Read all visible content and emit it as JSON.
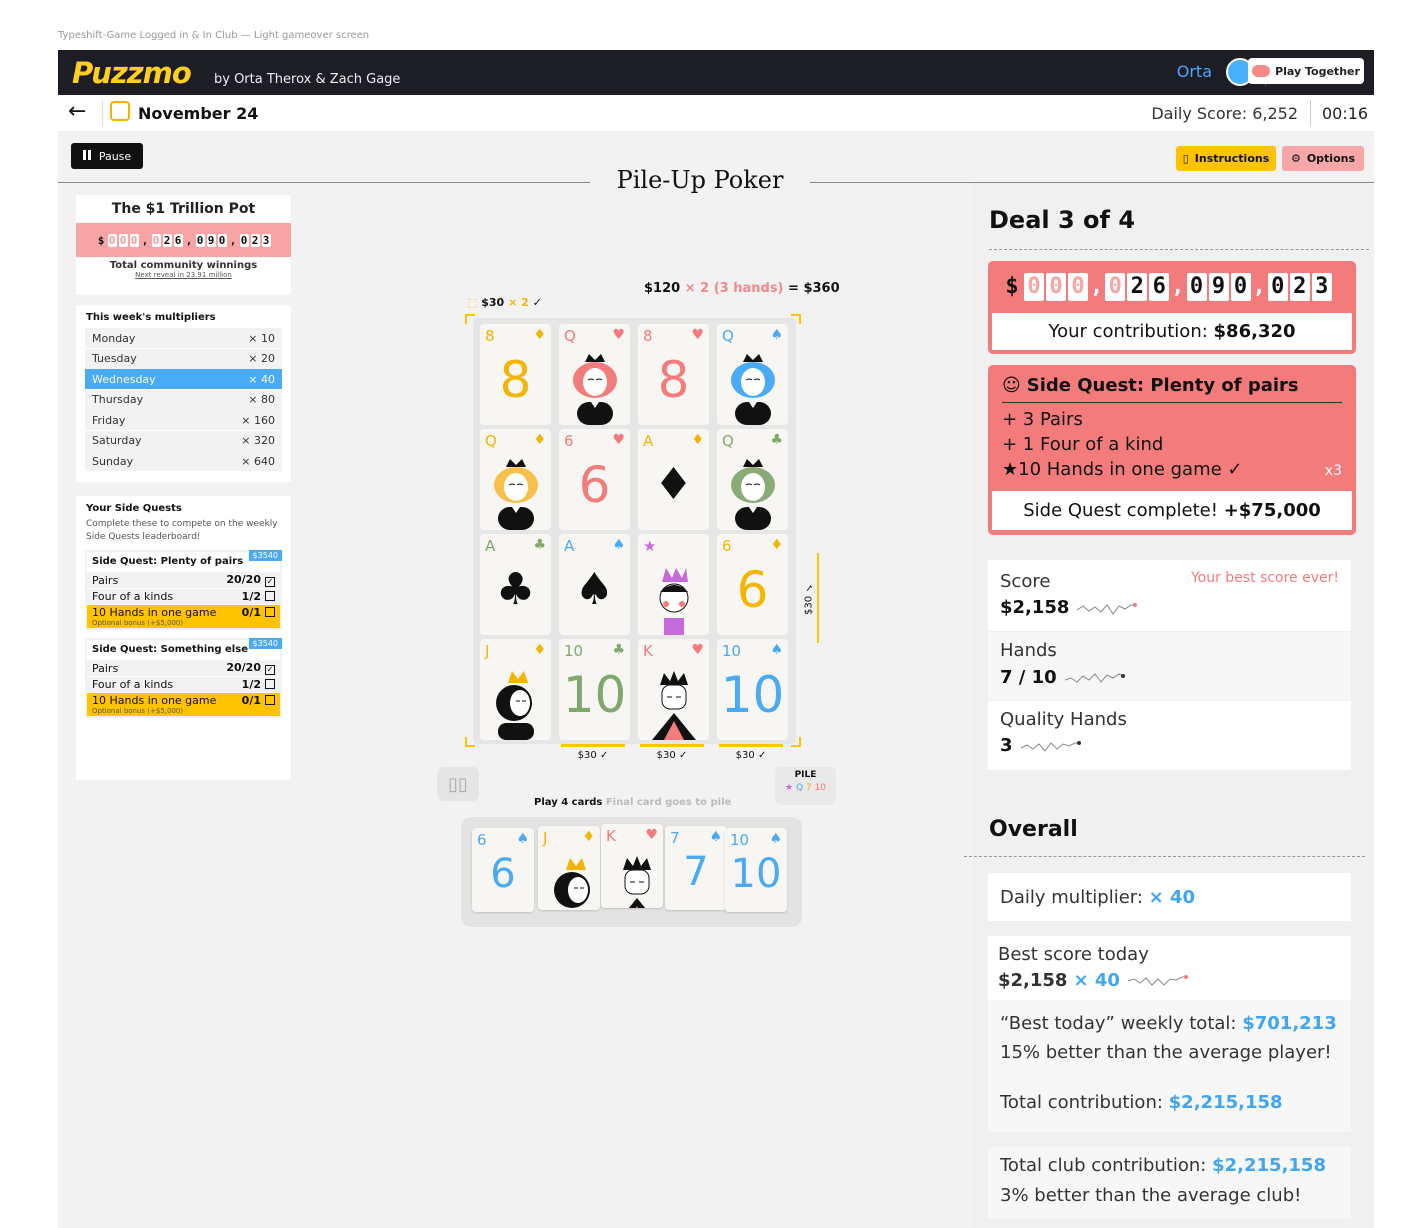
{
  "caption": "Typeshift-Game Logged in & In Club — Light gameover screen",
  "header": {
    "logo": "Puzzmo",
    "byline": "by Orta Therox & Zach Gage",
    "username": "Orta",
    "play_together": "Play Together"
  },
  "datebar": {
    "date": "November 24",
    "daily_score": "Daily Score: 6,252",
    "timer": "00:16"
  },
  "toolbar": {
    "pause": "Pause",
    "instructions": "Instructions",
    "options": "Options",
    "game_title": "Pile-Up Poker"
  },
  "pot": {
    "title": "The $1 Trillion Pot",
    "digits": [
      "0",
      "0",
      "0",
      "0",
      "2",
      "6",
      "0",
      "9",
      "0",
      "0",
      "2",
      "3"
    ],
    "currency": "$",
    "label": "Total community winnings",
    "next_reveal": "Next reveal in 23.91 million"
  },
  "multipliers": {
    "title": "This week's multipliers",
    "days": [
      {
        "day": "Monday",
        "mult": "× 10"
      },
      {
        "day": "Tuesday",
        "mult": "× 20"
      },
      {
        "day": "Wednesday",
        "mult": "× 40"
      },
      {
        "day": "Thursday",
        "mult": "× 80"
      },
      {
        "day": "Friday",
        "mult": "× 160"
      },
      {
        "day": "Saturday",
        "mult": "× 320"
      },
      {
        "day": "Sunday",
        "mult": "× 640"
      }
    ],
    "selected_index": 2
  },
  "side_quests": {
    "title": "Your Side Quests",
    "description": "Complete these to compete on the weekly Side Quests leaderboard!",
    "quests": [
      {
        "name": "Side Quest: Plenty of pairs",
        "badge": "$3540",
        "rows": [
          {
            "label": "Pairs",
            "value": "20/20"
          },
          {
            "label": "Four of a kinds",
            "value": "1/2"
          }
        ],
        "optional": {
          "label": "10 Hands in one game",
          "value": "0/1",
          "note": "Optional bonus (+$5,000)"
        }
      },
      {
        "name": "Side Quest: Something else",
        "badge": "$3540",
        "rows": [
          {
            "label": "Pairs",
            "value": "20/20"
          },
          {
            "label": "Four of a kinds",
            "value": "1/2"
          }
        ],
        "optional": {
          "label": "10 Hands in one game",
          "value": "0/1",
          "note": "Optional bonus (+$5,000)"
        }
      }
    ]
  },
  "board": {
    "formula": {
      "base": "$120",
      "mult": "× 2",
      "hands": "(3 hands)",
      "total": "= $360"
    },
    "row_bet": {
      "amount": "$30",
      "mult": "× 2",
      "check": "✓"
    },
    "side_bet": "$30 ✓",
    "column_bets": [
      "$30 ✓",
      "$30 ✓",
      "$30 ✓"
    ],
    "cards": [
      {
        "rank": "8",
        "suit": "♦",
        "color": "#f5b400",
        "kind": "num"
      },
      {
        "rank": "Q",
        "suit": "♥",
        "color": "#f47b7b",
        "kind": "queen",
        "hair": "#f47b7b"
      },
      {
        "rank": "8",
        "suit": "♥",
        "color": "#f47b7b",
        "kind": "num"
      },
      {
        "rank": "Q",
        "suit": "♠",
        "color": "#49aaf5",
        "kind": "queen",
        "hair": "#49aaf5"
      },
      {
        "rank": "Q",
        "suit": "♦",
        "color": "#f5b400",
        "kind": "queen",
        "hair": "#f7c04a"
      },
      {
        "rank": "6",
        "suit": "♥",
        "color": "#f47b7b",
        "kind": "num"
      },
      {
        "rank": "A",
        "suit": "♦",
        "color": "#f5b400",
        "kind": "ace"
      },
      {
        "rank": "Q",
        "suit": "♣",
        "color": "#7fa96a",
        "kind": "queen",
        "hair": "#8aab78"
      },
      {
        "rank": "A",
        "suit": "♣",
        "color": "#7fa96a",
        "kind": "ace"
      },
      {
        "rank": "A",
        "suit": "♠",
        "color": "#49aaf5",
        "kind": "ace"
      },
      {
        "rank": "★",
        "suit": "",
        "color": "#c56bd9",
        "kind": "joker"
      },
      {
        "rank": "6",
        "suit": "♦",
        "color": "#f5b400",
        "kind": "num"
      },
      {
        "rank": "J",
        "suit": "♦",
        "color": "#f5b400",
        "kind": "jack"
      },
      {
        "rank": "10",
        "suit": "♣",
        "color": "#7fa96a",
        "kind": "num"
      },
      {
        "rank": "K",
        "suit": "♥",
        "color": "#f47b7b",
        "kind": "king"
      },
      {
        "rank": "10",
        "suit": "♠",
        "color": "#49aaf5",
        "kind": "num"
      }
    ],
    "pile": {
      "label": "PILE",
      "cards": [
        "★",
        "Q",
        "7",
        "10"
      ]
    },
    "play_label": "Play 4 cards",
    "play_hint": "Final card goes to pile",
    "hand": [
      {
        "rank": "6",
        "suit": "♠",
        "color": "#49aaf5",
        "kind": "num"
      },
      {
        "rank": "J",
        "suit": "♦",
        "color": "#f5b400",
        "kind": "jack"
      },
      {
        "rank": "K",
        "suit": "♥",
        "color": "#f47b7b",
        "kind": "king"
      },
      {
        "rank": "7",
        "suit": "♠",
        "color": "#49aaf5",
        "kind": "num"
      },
      {
        "rank": "10",
        "suit": "♠",
        "color": "#49aaf5",
        "kind": "num"
      }
    ]
  },
  "results": {
    "deal": "Deal 3 of 4",
    "your_contribution_label": "Your contribution:",
    "your_contribution": "$86,320",
    "side_quest": {
      "title": "Side Quest: Plenty of pairs",
      "lines": [
        "+ 3 Pairs",
        "+ 1 Four of a kind",
        "★10 Hands in one game ✓"
      ],
      "mult": "x3",
      "complete_label": "Side Quest complete!",
      "complete_value": "+$75,000"
    },
    "score_label": "Score",
    "score": "$2,158",
    "best_ever": "Your best score ever!",
    "hands_label": "Hands",
    "hands": "7 / 10",
    "quality_label": "Quality Hands",
    "quality": "3"
  },
  "overall": {
    "title": "Overall",
    "daily_mult_label": "Daily multiplier:",
    "daily_mult": "× 40",
    "best_today_label": "Best score today",
    "best_today": "$2,158",
    "best_today_mult": "× 40",
    "weekly_label": "“Best today” weekly total:",
    "weekly": "$701,213",
    "weekly_note": "15% better than the average player!",
    "total_label": "Total contribution:",
    "total": "$2,215,158",
    "club_label": "Total club contribution:",
    "club": "$2,215,158",
    "club_note": "3% better than the average club!"
  },
  "colors": {
    "accent_yellow": "#ffc300",
    "accent_red": "#f47b7b",
    "accent_blue": "#49aaf5",
    "dark": "#1d1d26"
  }
}
